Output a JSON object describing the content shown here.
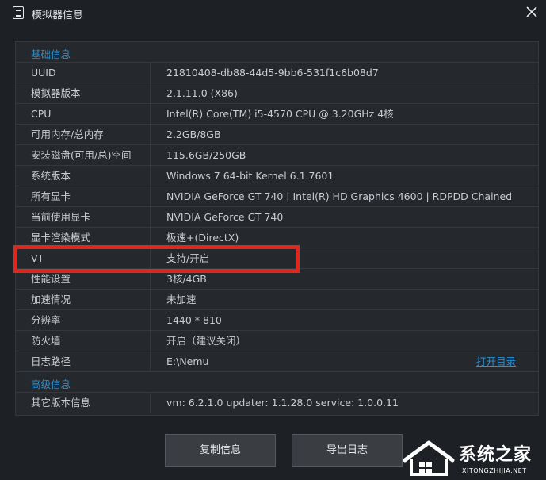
{
  "window": {
    "title": "模拟器信息",
    "icon": "document-icon",
    "close_icon": "close-icon"
  },
  "sections": {
    "basic": "基础信息",
    "advanced": "高级信息"
  },
  "rows": [
    {
      "key": "UUID",
      "value": "21810408-db88-44d5-9bb6-531f1c6b08d7"
    },
    {
      "key": "模拟器版本",
      "value": "2.1.11.0 (X86)"
    },
    {
      "key": "CPU",
      "value": "Intel(R) Core(TM) i5-4570 CPU @ 3.20GHz 4核"
    },
    {
      "key": "可用内存/总内存",
      "value": "2.2GB/8GB"
    },
    {
      "key": "安装磁盘(可用/总)空间",
      "value": "115.6GB/250GB"
    },
    {
      "key": "系统版本",
      "value": "Windows 7 64-bit Kernel 6.1.7601"
    },
    {
      "key": "所有显卡",
      "value": "NVIDIA GeForce GT 740 | Intel(R) HD Graphics 4600 | RDPDD Chained"
    },
    {
      "key": "当前使用显卡",
      "value": "NVIDIA GeForce GT 740"
    },
    {
      "key": "显卡渲染模式",
      "value": "极速+(DirectX)"
    },
    {
      "key": "VT",
      "value": "支持/开启"
    },
    {
      "key": "性能设置",
      "value": "3核/4GB"
    },
    {
      "key": "加速情况",
      "value": "未加速"
    },
    {
      "key": "分辨率",
      "value": "1440 * 810"
    },
    {
      "key": "防火墙",
      "value": "开启（建议关闭）"
    },
    {
      "key": "日志路径",
      "value": "E:\\Nemu",
      "link": "打开目录"
    }
  ],
  "advanced_rows": [
    {
      "key": "其它版本信息",
      "value": "vm: 6.2.1.0  updater: 1.1.28.0  service: 1.0.0.11"
    }
  ],
  "buttons": {
    "copy": "复制信息",
    "export": "导出日志"
  },
  "watermark": {
    "main": "系统之家",
    "sub": "XITONGZHIJIA.NET"
  },
  "colors": {
    "highlight": "#e3261b",
    "accent": "#2b8fd0",
    "background": "#1d2024"
  }
}
